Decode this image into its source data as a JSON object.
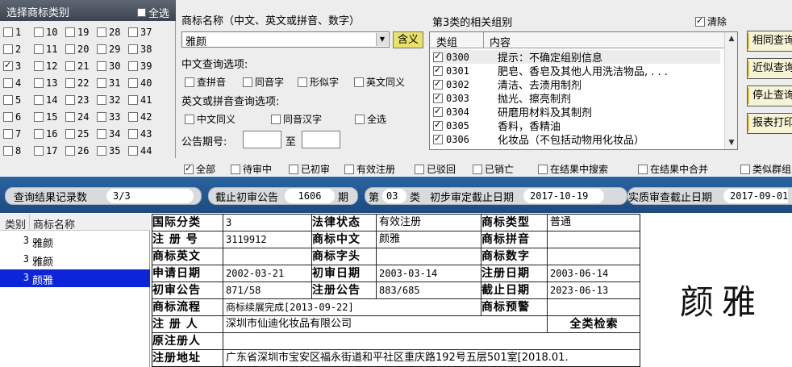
{
  "category_panel": {
    "title": "选择商标类别",
    "select_all_label": "全选",
    "select_all_checked": false,
    "classes": [
      {
        "n": "1",
        "checked": false
      },
      {
        "n": "2",
        "checked": false
      },
      {
        "n": "3",
        "checked": true
      },
      {
        "n": "4",
        "checked": false
      },
      {
        "n": "5",
        "checked": false
      },
      {
        "n": "6",
        "checked": false
      },
      {
        "n": "7",
        "checked": false
      },
      {
        "n": "8",
        "checked": false
      },
      {
        "n": "9",
        "checked": false
      },
      {
        "n": "10",
        "checked": false
      },
      {
        "n": "11",
        "checked": false
      },
      {
        "n": "12",
        "checked": false
      },
      {
        "n": "13",
        "checked": false
      },
      {
        "n": "14",
        "checked": false
      },
      {
        "n": "15",
        "checked": false
      },
      {
        "n": "16",
        "checked": false
      },
      {
        "n": "17",
        "checked": false
      },
      {
        "n": "18",
        "checked": false
      },
      {
        "n": "19",
        "checked": false
      },
      {
        "n": "20",
        "checked": false
      },
      {
        "n": "21",
        "checked": false
      },
      {
        "n": "22",
        "checked": false
      },
      {
        "n": "23",
        "checked": false
      },
      {
        "n": "24",
        "checked": false
      },
      {
        "n": "25",
        "checked": false
      },
      {
        "n": "26",
        "checked": false
      },
      {
        "n": "27",
        "checked": false
      },
      {
        "n": "28",
        "checked": false
      },
      {
        "n": "29",
        "checked": false
      },
      {
        "n": "30",
        "checked": false
      },
      {
        "n": "31",
        "checked": false
      },
      {
        "n": "32",
        "checked": false
      },
      {
        "n": "33",
        "checked": false
      },
      {
        "n": "34",
        "checked": false
      },
      {
        "n": "35",
        "checked": false
      },
      {
        "n": "36",
        "checked": false
      },
      {
        "n": "37",
        "checked": false
      },
      {
        "n": "38",
        "checked": false
      },
      {
        "n": "39",
        "checked": false
      },
      {
        "n": "40",
        "checked": false
      },
      {
        "n": "41",
        "checked": false
      },
      {
        "n": "42",
        "checked": false
      },
      {
        "n": "43",
        "checked": false
      },
      {
        "n": "44",
        "checked": false
      },
      {
        "n": "45",
        "checked": false
      }
    ]
  },
  "query": {
    "name_label": "商标名称（中文、英文或拼音、数字）",
    "name_value": "雅颜",
    "meaning_button": "含义",
    "cn_options_label": "中文查询选项:",
    "cn_options": [
      {
        "label": "查拼音",
        "checked": false
      },
      {
        "label": "同音字",
        "checked": false
      },
      {
        "label": "形似字",
        "checked": false
      },
      {
        "label": "英文同义",
        "checked": false
      }
    ],
    "en_options_label": "英文或拼音查询选项:",
    "en_options": [
      {
        "label": "中文同义",
        "checked": false
      },
      {
        "label": "同音汉字",
        "checked": false
      },
      {
        "label": "全选",
        "checked": false
      }
    ],
    "announce_label": "公告期号:",
    "announce_to": "至"
  },
  "groups": {
    "title": "第3类的相关组别",
    "clear_label": "清除",
    "clear_checked": true,
    "col_group": "类组",
    "col_content": "内容",
    "rows": [
      {
        "code": "0300",
        "content": "提示：不确定组别信息",
        "checked": true
      },
      {
        "code": "0301",
        "content": "肥皂、香皂及其他人用洗洁物品, . . .",
        "checked": true
      },
      {
        "code": "0302",
        "content": "清洁、去渍用制剂",
        "checked": true
      },
      {
        "code": "0303",
        "content": "抛光、擦亮制剂",
        "checked": true
      },
      {
        "code": "0304",
        "content": "研磨用材料及其制剂",
        "checked": true
      },
      {
        "code": "0305",
        "content": "香料，香精油",
        "checked": true
      },
      {
        "code": "0306",
        "content": "化妆品（不包括动物用化妆品）",
        "checked": true
      }
    ]
  },
  "side_buttons": [
    "相同查询",
    "近似查询",
    "停止查询",
    "报表打印"
  ],
  "filters": [
    {
      "label": "全部",
      "checked": true
    },
    {
      "label": "待审中",
      "checked": false
    },
    {
      "label": "已初审",
      "checked": false
    },
    {
      "label": "有效注册",
      "checked": false
    },
    {
      "label": "已驳回",
      "checked": false
    },
    {
      "label": "已销亡",
      "checked": false
    },
    {
      "label": "在结果中搜索",
      "checked": false
    },
    {
      "label": "在结果中合并",
      "checked": false
    },
    {
      "label": "类似群组",
      "checked": false
    }
  ],
  "status_bar": {
    "records_label": "查询结果记录数",
    "records_value": "3/3",
    "cutoff_label": "截止初审公告",
    "cutoff_value": "1606",
    "cutoff_unit": "期",
    "class_prefix": "第",
    "class_value": "03",
    "class_suffix": "类",
    "prelim_label": "初步审定截止日期",
    "prelim_value": "2017-10-19",
    "substantive_label": "实质审查截止日期",
    "substantive_value": "2017-09-01"
  },
  "results": {
    "col_class": "类别",
    "col_name": "商标名称",
    "rows": [
      {
        "class": "3",
        "name": "雅颜",
        "selected": false
      },
      {
        "class": "3",
        "name": "雅颜",
        "selected": false
      },
      {
        "class": "3",
        "name": "颜雅",
        "selected": true
      }
    ]
  },
  "detail": {
    "intl_class_label": "国际分类",
    "intl_class": "3",
    "legal_status_label": "法律状态",
    "legal_status": "有效注册",
    "mark_type_label": "商标类型",
    "mark_type": "普通",
    "reg_no_label": "注 册 号",
    "reg_no": "3119912",
    "mark_cn_label": "商标中文",
    "mark_cn": "颜雅",
    "mark_pinyin_label": "商标拼音",
    "mark_pinyin": "",
    "mark_en_label": "商标英文",
    "mark_en": "",
    "mark_initial_label": "商标字头",
    "mark_initial": "",
    "mark_digits_label": "商标数字",
    "mark_digits": "",
    "apply_date_label": "申请日期",
    "apply_date": "2002-03-21",
    "prelim_date_label": "初审日期",
    "prelim_date": "2003-03-14",
    "reg_date_label": "注册日期",
    "reg_date": "2003-06-14",
    "prelim_ann_label": "初审公告",
    "prelim_ann": "871/58",
    "reg_ann_label": "注册公告",
    "reg_ann": "883/685",
    "expiry_label": "截止日期",
    "expiry": "2023-06-13",
    "flow_label": "商标流程",
    "flow": "商标续展完成[2013-09-22]",
    "warning_label": "商标预警",
    "warning": "",
    "registrant_label": "注 册 人",
    "registrant": "深圳市仙迪化妆品有限公司",
    "all_class_search": "全类检索",
    "orig_registrant_label": "原注册人",
    "orig_registrant": "",
    "address_label": "注册地址",
    "address": "广东省深圳市宝安区福永街道和平社区重庆路192号五层501室[2018.01."
  },
  "preview_text": "颜雅"
}
